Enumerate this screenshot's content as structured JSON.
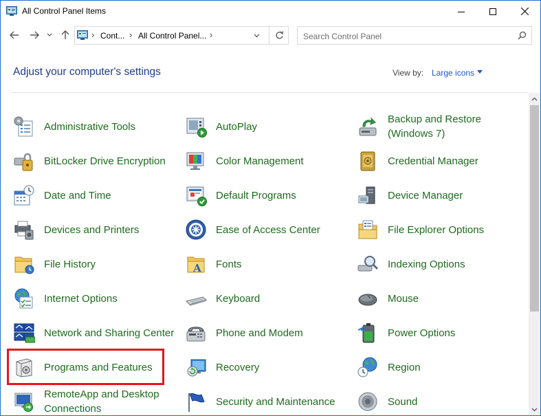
{
  "window": {
    "title": "All Control Panel Items"
  },
  "address": {
    "crumb1": "Cont...",
    "crumb2": "All Control Panel..."
  },
  "search": {
    "placeholder": "Search Control Panel"
  },
  "header": {
    "heading": "Adjust your computer's settings",
    "view_by_label": "View by:",
    "view_by_value": "Large icons"
  },
  "items": [
    {
      "label": "Administrative Tools",
      "icon": "admin-tools-icon"
    },
    {
      "label": "AutoPlay",
      "icon": "autoplay-icon"
    },
    {
      "label": "Backup and Restore (Windows 7)",
      "icon": "backup-restore-icon"
    },
    {
      "label": "BitLocker Drive Encryption",
      "icon": "bitlocker-icon"
    },
    {
      "label": "Color Management",
      "icon": "color-management-icon"
    },
    {
      "label": "Credential Manager",
      "icon": "credential-manager-icon"
    },
    {
      "label": "Date and Time",
      "icon": "date-time-icon"
    },
    {
      "label": "Default Programs",
      "icon": "default-programs-icon"
    },
    {
      "label": "Device Manager",
      "icon": "device-manager-icon"
    },
    {
      "label": "Devices and Printers",
      "icon": "devices-printers-icon"
    },
    {
      "label": "Ease of Access Center",
      "icon": "ease-of-access-icon"
    },
    {
      "label": "File Explorer Options",
      "icon": "file-explorer-options-icon"
    },
    {
      "label": "File History",
      "icon": "file-history-icon"
    },
    {
      "label": "Fonts",
      "icon": "fonts-icon"
    },
    {
      "label": "Indexing Options",
      "icon": "indexing-options-icon"
    },
    {
      "label": "Internet Options",
      "icon": "internet-options-icon"
    },
    {
      "label": "Keyboard",
      "icon": "keyboard-icon"
    },
    {
      "label": "Mouse",
      "icon": "mouse-icon"
    },
    {
      "label": "Network and Sharing Center",
      "icon": "network-sharing-icon"
    },
    {
      "label": "Phone and Modem",
      "icon": "phone-modem-icon"
    },
    {
      "label": "Power Options",
      "icon": "power-options-icon"
    },
    {
      "label": "Programs and Features",
      "icon": "programs-features-icon"
    },
    {
      "label": "Recovery",
      "icon": "recovery-icon"
    },
    {
      "label": "Region",
      "icon": "region-icon"
    },
    {
      "label": "RemoteApp and Desktop Connections",
      "icon": "remoteapp-icon"
    },
    {
      "label": "Security and Maintenance",
      "icon": "security-maintenance-icon"
    },
    {
      "label": "Sound",
      "icon": "sound-icon"
    }
  ],
  "colors": {
    "link_green": "#1e6b1e",
    "heading_blue": "#1e3c8c",
    "highlight_red": "#e8151b"
  }
}
